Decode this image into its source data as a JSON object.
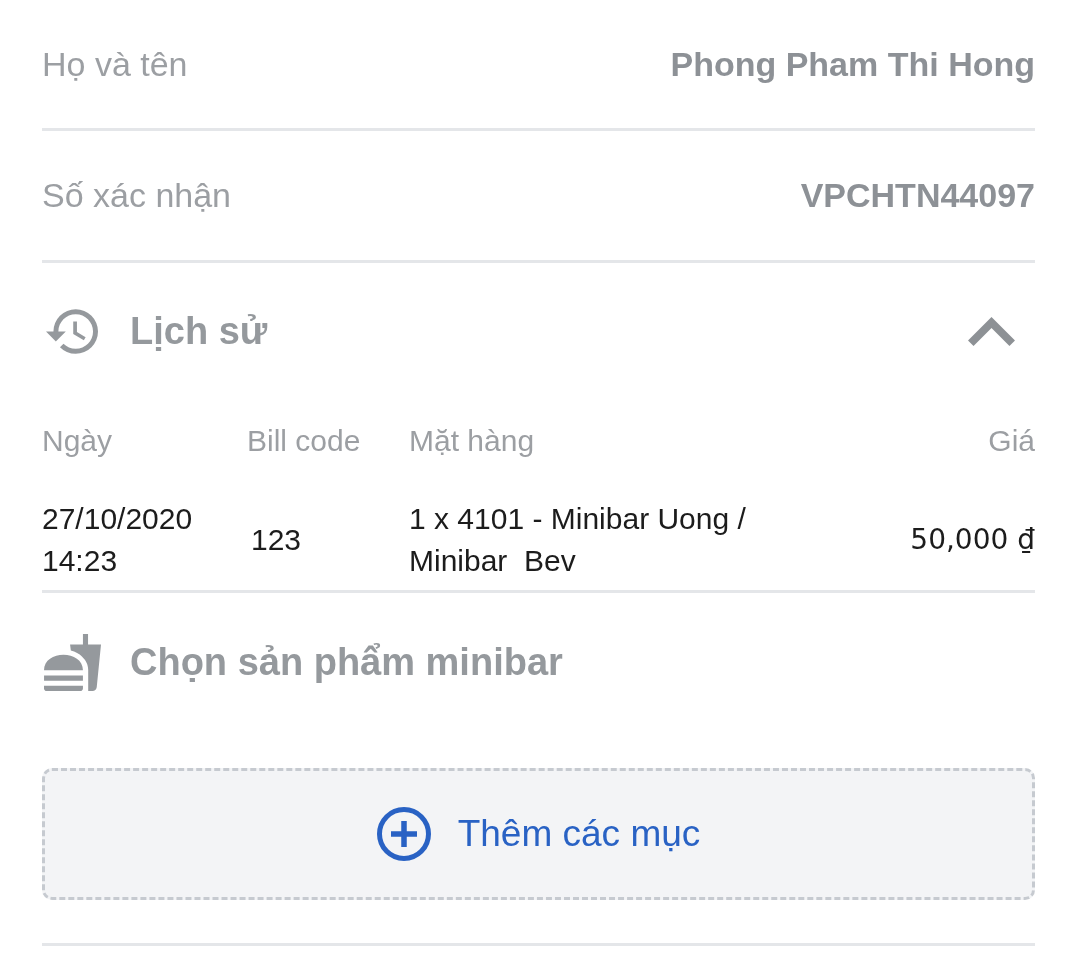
{
  "fields": [
    {
      "label": "Họ và tên",
      "value": "Phong Pham Thi Hong"
    },
    {
      "label": "Số xác nhận",
      "value": "VPCHTN44097"
    }
  ],
  "history": {
    "title": "Lịch sử",
    "expanded": true,
    "columns": [
      "Ngày",
      "Bill code",
      "Mặt hàng",
      "Giá"
    ],
    "rows": [
      {
        "date": "27/10/2020 14:23",
        "bill_code": "123",
        "item": "1 x 4101 - Minibar Uong / Minibar  Bev",
        "price": "50,000 ₫"
      }
    ]
  },
  "minibar": {
    "title": "Chọn sản phẩm minibar",
    "add_button": "Thêm các mục"
  }
}
